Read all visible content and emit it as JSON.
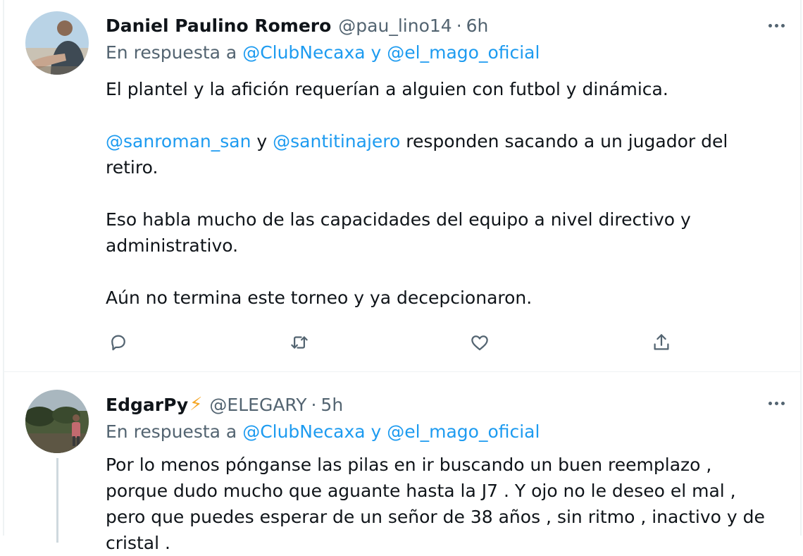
{
  "tweets": [
    {
      "name": "Daniel Paulino Romero",
      "handle": "@pau_lino14",
      "separator": "·",
      "time": "6h",
      "replying_prefix": "En respuesta a",
      "replying_to": [
        "@ClubNecaxa",
        "@el_mago_oficial"
      ],
      "replying_conjunction": "y",
      "paragraph1": "El plantel y la afición requerían a alguien con futbol y dinámica.",
      "paragraph2": {
        "mention1": "@sanroman_san",
        "conjunction": " y ",
        "mention2": "@santitinajero",
        "rest": " responden sacando a un jugador del retiro."
      },
      "paragraph3": "Eso habla mucho de las capacidades del equipo a nivel directivo y administrativo.",
      "paragraph4": "Aún no termina este torneo y ya decepcionaron.",
      "actions": [
        "reply-icon",
        "retweet-icon",
        "like-icon",
        "share-icon"
      ]
    },
    {
      "name": "EdgarPy",
      "name_emoji": "⚡",
      "handle": "@ELEGARY",
      "separator": "·",
      "time": "5h",
      "replying_prefix": "En respuesta a",
      "replying_to": [
        "@ClubNecaxa",
        "@el_mago_oficial"
      ],
      "replying_conjunction": "y",
      "paragraph1": "Por lo menos pónganse las pilas en ir buscando un buen reemplazo , porque dudo mucho que aguante hasta la J7 . Y ojo no le deseo el mal , pero que puedes esperar de un señor de 38 años , sin ritmo , inactivo y de cristal ."
    }
  ],
  "colors": {
    "accent": "#1d9bf0",
    "secondary_text": "#536471",
    "primary_text": "#0f1419",
    "divider": "#eff3f4",
    "bolt": "#f5a623"
  }
}
